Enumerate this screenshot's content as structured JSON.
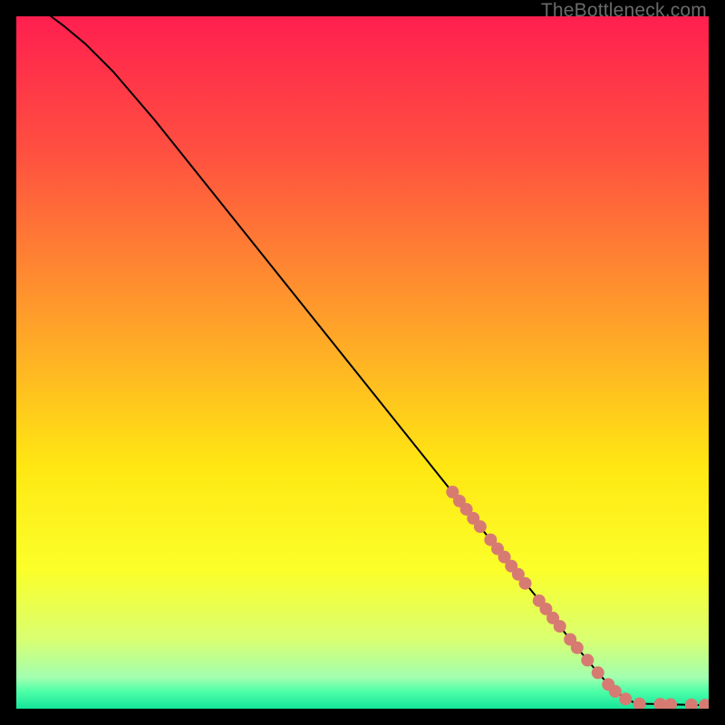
{
  "watermark": "TheBottleneck.com",
  "chart_data": {
    "type": "line",
    "title": "",
    "xlabel": "",
    "ylabel": "",
    "xlim": [
      0,
      100
    ],
    "ylim": [
      0,
      100
    ],
    "grid": false,
    "legend": false,
    "background_gradient": {
      "orientation": "vertical",
      "stops": [
        {
          "pos": 0.0,
          "color": "#ff1f4f"
        },
        {
          "pos": 0.2,
          "color": "#ff5140"
        },
        {
          "pos": 0.45,
          "color": "#ffa329"
        },
        {
          "pos": 0.65,
          "color": "#ffe712"
        },
        {
          "pos": 0.8,
          "color": "#fbff2a"
        },
        {
          "pos": 0.9,
          "color": "#d9ff71"
        },
        {
          "pos": 0.955,
          "color": "#a2ffb0"
        },
        {
          "pos": 0.975,
          "color": "#4effa8"
        },
        {
          "pos": 1.0,
          "color": "#14e59a"
        }
      ]
    },
    "series": [
      {
        "name": "curve",
        "stroke": "#000000",
        "stroke_width": 2,
        "x": [
          5,
          7,
          10,
          14,
          20,
          30,
          40,
          50,
          60,
          70,
          75,
          80,
          84,
          86,
          88,
          89.5,
          91,
          93,
          95,
          97,
          99.5
        ],
        "y": [
          100,
          98.5,
          96,
          92,
          85,
          72.5,
          60,
          47.5,
          35,
          22.5,
          16.3,
          10,
          5.2,
          3.0,
          1.4,
          0.8,
          0.7,
          0.65,
          0.6,
          0.55,
          0.5
        ]
      }
    ],
    "markers": {
      "name": "highlighted-points",
      "color": "#d77b72",
      "radius": 7,
      "points": [
        {
          "x": 63.0,
          "y": 31.3
        },
        {
          "x": 64.0,
          "y": 30.0
        },
        {
          "x": 65.0,
          "y": 28.8
        },
        {
          "x": 66.0,
          "y": 27.5
        },
        {
          "x": 67.0,
          "y": 26.3
        },
        {
          "x": 68.5,
          "y": 24.4
        },
        {
          "x": 69.5,
          "y": 23.1
        },
        {
          "x": 70.5,
          "y": 21.9
        },
        {
          "x": 71.5,
          "y": 20.6
        },
        {
          "x": 72.5,
          "y": 19.4
        },
        {
          "x": 73.5,
          "y": 18.1
        },
        {
          "x": 75.5,
          "y": 15.6
        },
        {
          "x": 76.5,
          "y": 14.4
        },
        {
          "x": 77.5,
          "y": 13.1
        },
        {
          "x": 78.5,
          "y": 11.9
        },
        {
          "x": 80.0,
          "y": 10.0
        },
        {
          "x": 81.0,
          "y": 8.8
        },
        {
          "x": 82.5,
          "y": 7.0
        },
        {
          "x": 84.0,
          "y": 5.2
        },
        {
          "x": 85.5,
          "y": 3.5
        },
        {
          "x": 86.5,
          "y": 2.5
        },
        {
          "x": 88.0,
          "y": 1.4
        },
        {
          "x": 90.0,
          "y": 0.7
        },
        {
          "x": 93.0,
          "y": 0.65
        },
        {
          "x": 94.5,
          "y": 0.6
        },
        {
          "x": 97.5,
          "y": 0.55
        },
        {
          "x": 99.5,
          "y": 0.5
        }
      ]
    }
  }
}
